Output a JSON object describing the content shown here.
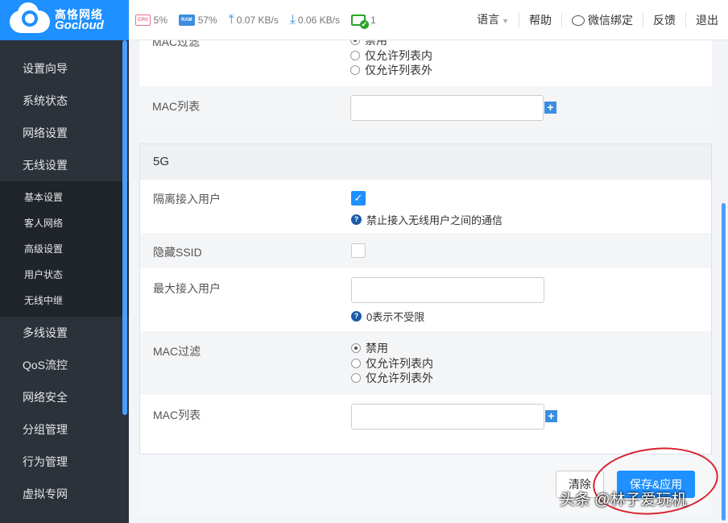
{
  "brand": {
    "name_cn": "高恪网络",
    "name_en": "Gocloud"
  },
  "topbar": {
    "cpu_chip": "CPU",
    "cpu": "5%",
    "ram_chip": "RAM",
    "ram": "57%",
    "upload": "0.07 KB/s",
    "download": "0.06 KB/s",
    "devices": "1",
    "links": {
      "language": "语言",
      "help": "帮助",
      "wechat": "微信绑定",
      "feedback": "反馈",
      "logout": "退出"
    }
  },
  "sidebar": {
    "items_top": [
      "设置向导",
      "系统状态",
      "网络设置",
      "无线设置"
    ],
    "submenu": [
      "基本设置",
      "客人网络",
      "高级设置",
      "用户状态",
      "无线中继"
    ],
    "items_bottom": [
      "多线设置",
      "QoS流控",
      "网络安全",
      "分组管理",
      "行为管理",
      "虚拟专网"
    ]
  },
  "card_24g": {
    "mac_filter_label": "MAC过滤",
    "mac_filter_options": [
      "禁用",
      "仅允许列表内",
      "仅允许列表外"
    ],
    "mac_list_label": "MAC列表"
  },
  "card_5g": {
    "title": "5G",
    "isolate_label": "隔离接入用户",
    "isolate_checked": true,
    "isolate_hint": "禁止接入无线用户之间的通信",
    "hide_ssid_label": "隐藏SSID",
    "hide_ssid_checked": false,
    "max_users_label": "最大接入用户",
    "max_users_value": "",
    "max_users_hint": "0表示不受限",
    "mac_filter_label": "MAC过滤",
    "mac_filter_options": [
      "禁用",
      "仅允许列表内",
      "仅允许列表外"
    ],
    "mac_filter_selected": "禁用",
    "mac_list_label": "MAC列表"
  },
  "footer": {
    "clear_label": "清除",
    "save_label": "保存&应用"
  },
  "watermark": "头条 @林子爱玩机",
  "colors": {
    "primary": "#1e90ff",
    "sidebar": "#2b323a",
    "annotation": "#d9232d"
  }
}
